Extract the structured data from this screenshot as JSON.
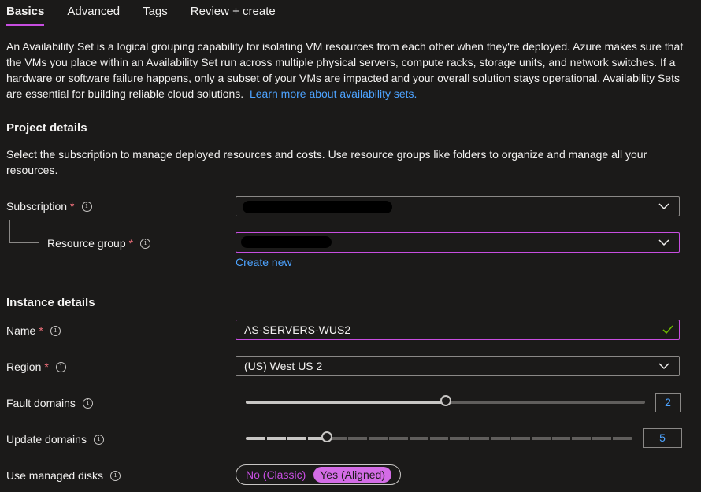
{
  "tabs": [
    {
      "label": "Basics",
      "active": true
    },
    {
      "label": "Advanced",
      "active": false
    },
    {
      "label": "Tags",
      "active": false
    },
    {
      "label": "Review + create",
      "active": false
    }
  ],
  "intro": {
    "text": "An Availability Set is a logical grouping capability for isolating VM resources from each other when they're deployed. Azure makes sure that the VMs you place within an Availability Set run across multiple physical servers, compute racks, storage units, and network switches. If a hardware or software failure happens, only a subset of your VMs are impacted and your overall solution stays operational. Availability Sets are essential for building reliable cloud solutions.",
    "link": "Learn more about availability sets."
  },
  "project": {
    "title": "Project details",
    "description": "Select the subscription to manage deployed resources and costs. Use resource groups like folders to organize and manage all your resources.",
    "subscription_label": "Subscription",
    "resource_group_label": "Resource group",
    "create_new": "Create new"
  },
  "instance": {
    "title": "Instance details",
    "name_label": "Name",
    "name_value": "AS-SERVERS-WUS2",
    "region_label": "Region",
    "region_value": "(US) West US 2",
    "fault_label": "Fault domains",
    "fault_value": "2",
    "fault_max": 3,
    "update_label": "Update domains",
    "update_value": "5",
    "update_max": 20,
    "disks_label": "Use managed disks",
    "disks_options": [
      "No (Classic)",
      "Yes (Aligned)"
    ],
    "disks_selected": "Yes (Aligned)"
  },
  "required_marker": "*",
  "info_glyph": "i",
  "colors": {
    "accent": "#c74ee0",
    "link": "#4da3ff",
    "required": "#f1707b",
    "background": "#1b1a19"
  }
}
